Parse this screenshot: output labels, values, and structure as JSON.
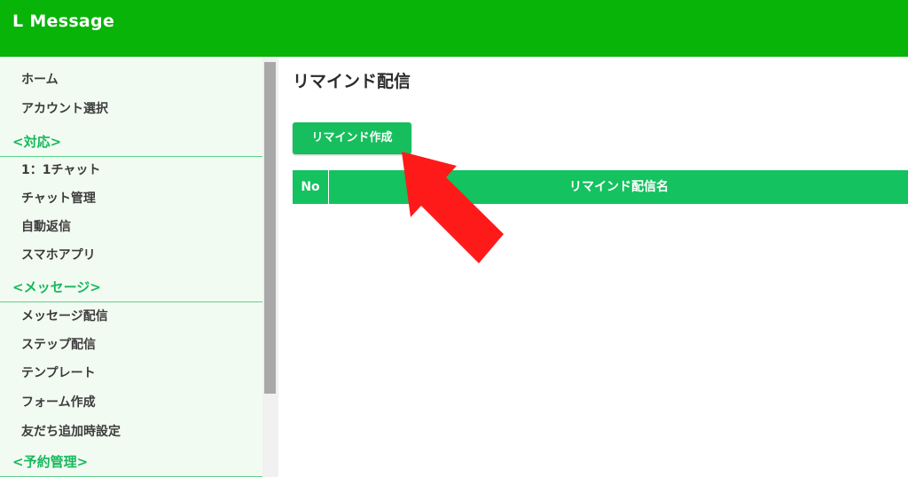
{
  "header": {
    "app_title": "L Message",
    "color": "#08b408"
  },
  "sidebar": {
    "items": {
      "home": "ホーム",
      "account_select": "アカウント選択",
      "section_support": "<対応>",
      "chat_1to1": "1：1チャット",
      "chat_manage": "チャット管理",
      "auto_reply": "自動返信",
      "smartphone_app": "スマホアプリ",
      "section_message": "<メッセージ>",
      "message_delivery": "メッセージ配信",
      "step_delivery": "ステップ配信",
      "template": "テンプレート",
      "form_create": "フォーム作成",
      "friend_add_settings": "友だち追加時設定",
      "section_reservation": "<予約管理>"
    },
    "section_color": "#17b85c"
  },
  "main": {
    "page_title": "リマインド配信",
    "create_button_label": "リマインド作成",
    "table": {
      "columns": [
        "No",
        "リマインド配信名"
      ]
    },
    "accent_color": "#14c25f"
  },
  "annotation": {
    "icon": "red-arrow-icon",
    "color": "#ff1a1a"
  }
}
